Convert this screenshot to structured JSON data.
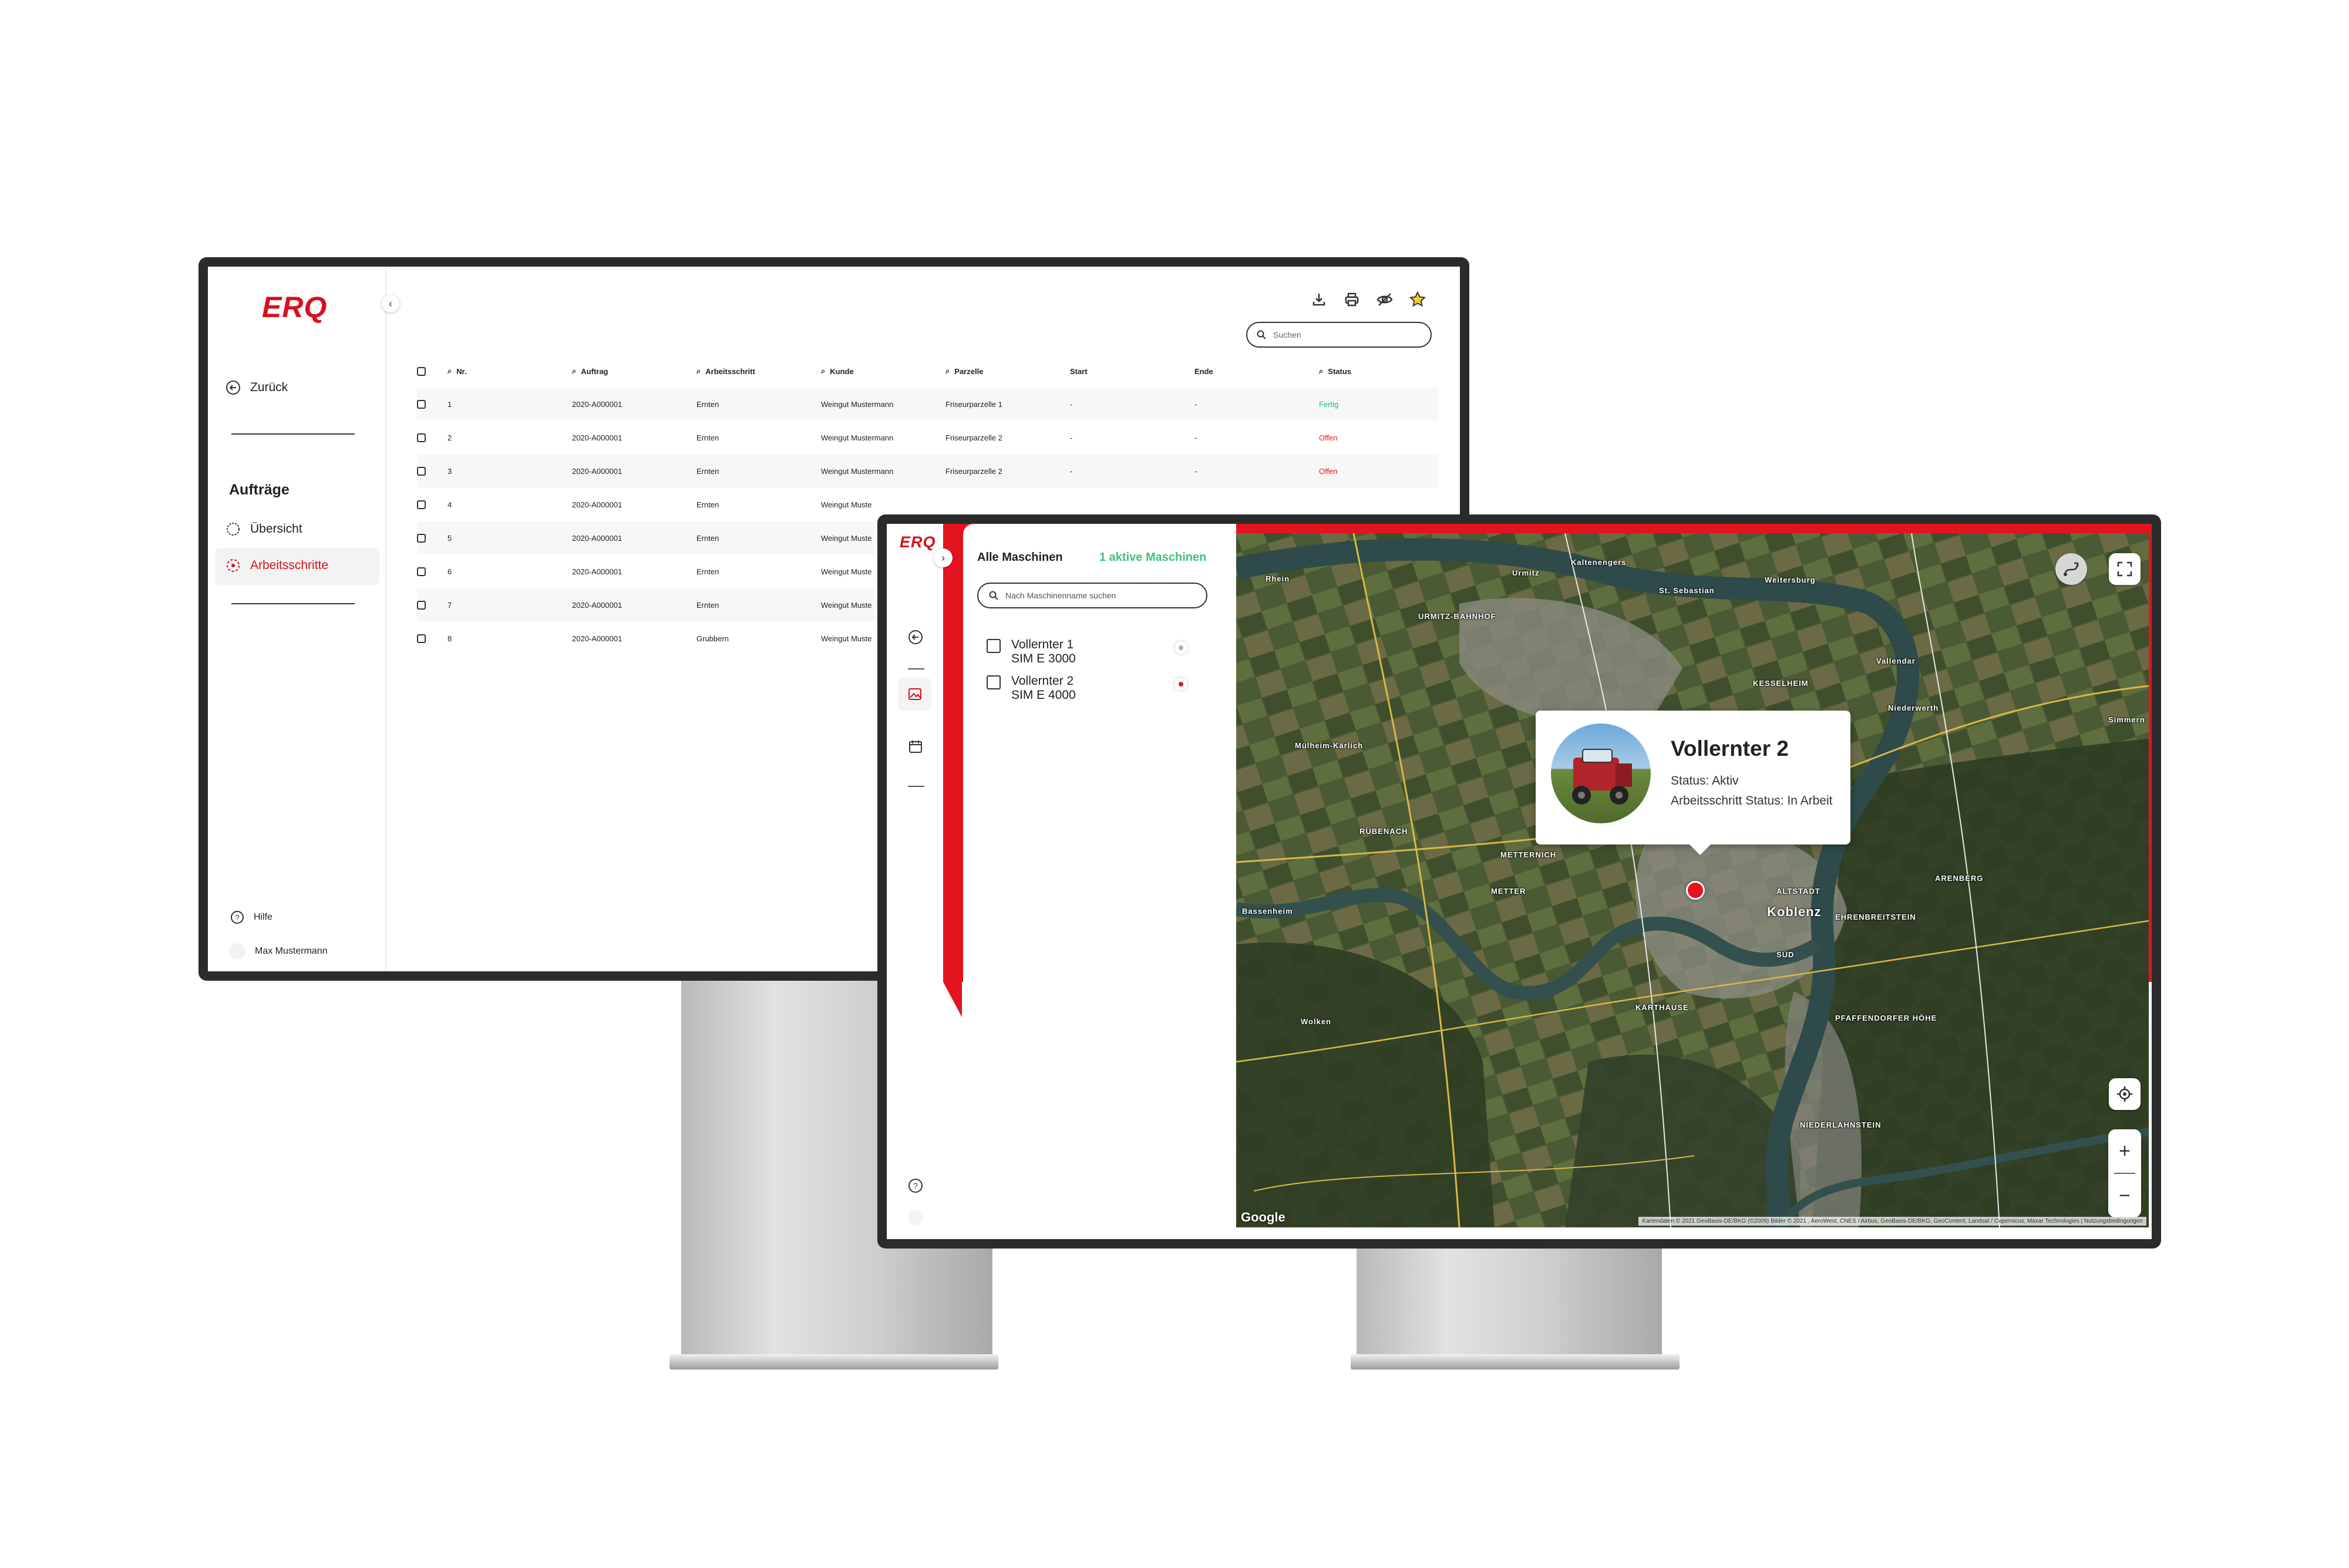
{
  "monitor1": {
    "logo": "ERQ",
    "nav": {
      "back_label": "Zurück",
      "section_title": "Aufträge",
      "overview_label": "Übersicht",
      "steps_label": "Arbeitsschritte",
      "help_label": "Hilfe",
      "user_name": "Max Mustermann"
    },
    "toolbar_icons": [
      "download-icon",
      "print-icon",
      "visibility-off-icon",
      "star-icon"
    ],
    "search": {
      "placeholder": "Suchen"
    },
    "table": {
      "columns": [
        "Nr.",
        "Auftrag",
        "Arbeitsschritt",
        "Kunde",
        "Parzelle",
        "Start",
        "Ende",
        "Status"
      ],
      "rows": [
        {
          "nr": "1",
          "auftrag": "2020-A000001",
          "schritt": "Ernten",
          "kunde": "Weingut Mustermann",
          "parzelle": "Friseurparzelle 1",
          "start": "-",
          "ende": "-",
          "status": "Fertig"
        },
        {
          "nr": "2",
          "auftrag": "2020-A000001",
          "schritt": "Ernten",
          "kunde": "Weingut Mustermann",
          "parzelle": "Friseurparzelle 2",
          "start": "-",
          "ende": "-",
          "status": "Offen"
        },
        {
          "nr": "3",
          "auftrag": "2020-A000001",
          "schritt": "Ernten",
          "kunde": "Weingut Mustermann",
          "parzelle": "Friseurparzelle 2",
          "start": "-",
          "ende": "-",
          "status": "Offen"
        },
        {
          "nr": "4",
          "auftrag": "2020-A000001",
          "schritt": "Ernten",
          "kunde": "Weingut Muste",
          "parzelle": "",
          "start": "",
          "ende": "",
          "status": ""
        },
        {
          "nr": "5",
          "auftrag": "2020-A000001",
          "schritt": "Ernten",
          "kunde": "Weingut Muste",
          "parzelle": "",
          "start": "",
          "ende": "",
          "status": ""
        },
        {
          "nr": "6",
          "auftrag": "2020-A000001",
          "schritt": "Ernten",
          "kunde": "Weingut Muste",
          "parzelle": "",
          "start": "",
          "ende": "",
          "status": ""
        },
        {
          "nr": "7",
          "auftrag": "2020-A000001",
          "schritt": "Ernten",
          "kunde": "Weingut Muste",
          "parzelle": "",
          "start": "",
          "ende": "",
          "status": ""
        },
        {
          "nr": "8",
          "auftrag": "2020-A000001",
          "schritt": "Grubbern",
          "kunde": "Weingut Muste",
          "parzelle": "",
          "start": "",
          "ende": "",
          "status": ""
        }
      ]
    },
    "colors": {
      "brand_red": "#d8101e",
      "status_done": "#2bb673",
      "status_open": "#e3141f"
    }
  },
  "monitor2": {
    "logo": "ERQ",
    "panel": {
      "title": "Alle Maschinen",
      "active_count": "1 aktive Maschinen",
      "search_placeholder": "Nach Maschinenname suchen",
      "machines": [
        {
          "name": "Vollernter 1",
          "model": "SIM E 3000",
          "state": "inactive"
        },
        {
          "name": "Vollernter 2",
          "model": "SIM E 4000",
          "state": "active"
        }
      ]
    },
    "popup": {
      "title": "Vollernter 2",
      "status": "Status: Aktiv",
      "step_status": "Arbeitsschritt Status: In Arbeit"
    },
    "map": {
      "labels": [
        "Rhein",
        "Urmitz",
        "Kaltenengers",
        "St. Sebastian",
        "URMITZ-BAHNHOF",
        "Weitersburg",
        "Vallendar",
        "KESSELHEIM",
        "Niederwerth",
        "RÜBENACH",
        "METTERNICH",
        "METTER",
        "ALTSTADT",
        "Koblenz",
        "ARENBERG",
        "EHRENBREITSTEIN",
        "SÜD",
        "KARTHAUSE",
        "PFAFFENDORFER HÖHE",
        "NIEDERLAHNSTEIN",
        "Mülheim-Kärlich",
        "Bassenheim",
        "Wolken",
        "Simmern"
      ],
      "google_label": "Google",
      "attribution": "Kartendaten © 2021 GeoBasis-DE/BKG (©2009) Bilder © 2021 , AeroWest, CNES / Airbus, GeoBasis-DE/BKG, GeoContent, Landsat / Copernicus, Maxar Technologies | Nutzungsbedingungen",
      "controls": [
        "route-icon",
        "fullscreen-icon",
        "locate-icon",
        "zoom-in",
        "zoom-out"
      ]
    }
  }
}
